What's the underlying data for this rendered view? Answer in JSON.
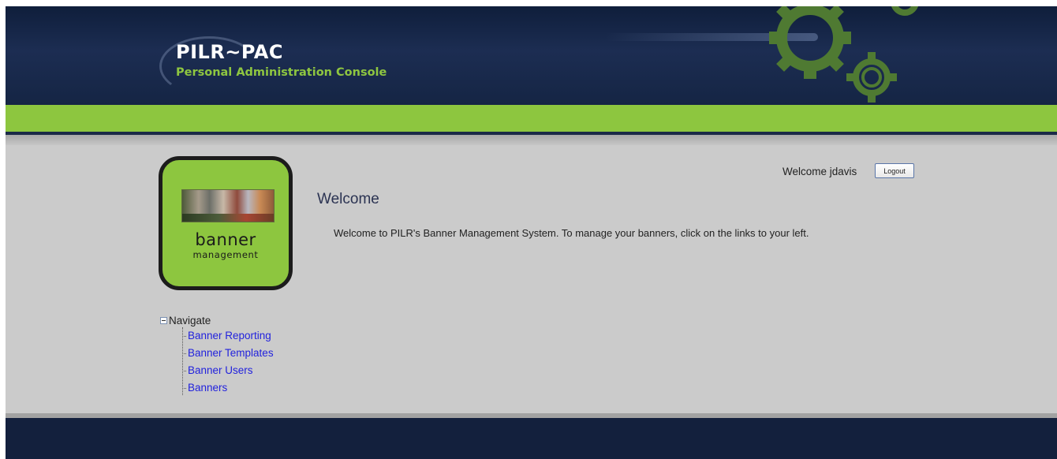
{
  "header": {
    "brand_title": "PILR~PAC",
    "brand_subtitle": "Personal Administration Console"
  },
  "logo": {
    "main_text": "banner",
    "sub_text": "management"
  },
  "nav": {
    "root_label": "Navigate",
    "items": [
      {
        "label": "Banner Reporting"
      },
      {
        "label": "Banner Templates"
      },
      {
        "label": "Banner Users"
      },
      {
        "label": "Banners"
      }
    ]
  },
  "user": {
    "welcome_text": "Welcome jdavis",
    "logout_label": "Logout"
  },
  "main": {
    "title": "Welcome",
    "message": "Welcome to PILR's Banner Management System. To manage your banners, click on the links to your left."
  },
  "colors": {
    "header_navy": "#1c2d52",
    "accent_green": "#8dc63f",
    "content_gray": "#cbcbcb",
    "link_blue": "#2222dd"
  }
}
